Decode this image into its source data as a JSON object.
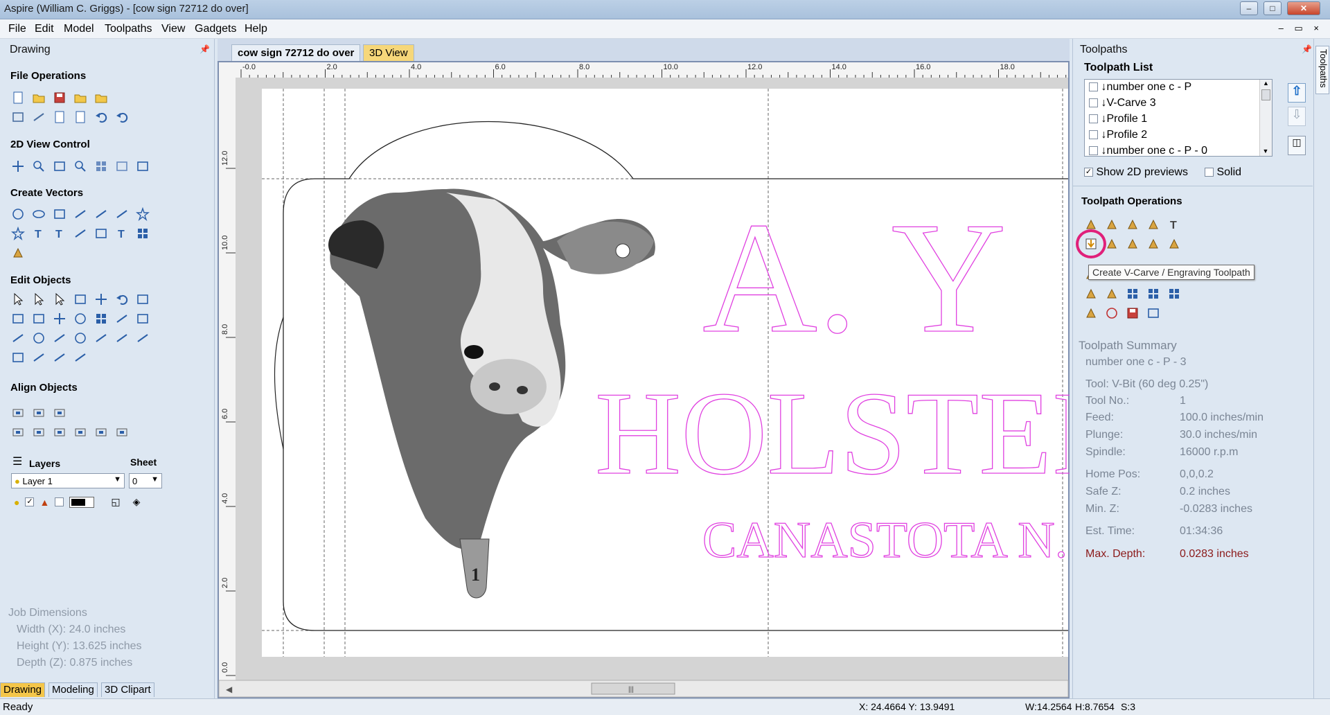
{
  "window": {
    "title": "Aspire (William C. Griggs) - [cow sign 72712 do over]"
  },
  "menu": [
    "File",
    "Edit",
    "Model",
    "Toolpaths",
    "View",
    "Gadgets",
    "Help"
  ],
  "left_panel": {
    "title": "Drawing",
    "sections": {
      "file_operations": "File Operations",
      "view_control": "2D View Control",
      "create_vectors": "Create Vectors",
      "edit_objects": "Edit Objects",
      "align_objects": "Align Objects"
    },
    "layers_label": "Layers",
    "sheet_label": "Sheet",
    "layer_select": "Layer 1",
    "sheet_select": "0",
    "job_dimensions": {
      "title": "Job Dimensions",
      "width": "Width  (X): 24.0 inches",
      "height": "Height (Y): 13.625 inches",
      "depth": "Depth  (Z): 0.875 inches"
    },
    "bottom_tabs": [
      "Drawing",
      "Modeling",
      "3D Clipart"
    ]
  },
  "document": {
    "tabs": [
      "cow sign 72712 do over",
      "3D View"
    ],
    "ruler_x": [
      "-0.0",
      "2.0",
      "4.0",
      "6.0",
      "8.0",
      "10.0",
      "12.0",
      "14.0",
      "16.0",
      "18.0"
    ],
    "ruler_y": [
      "12.0",
      "10.0",
      "8.0",
      "6.0",
      "4.0",
      "2.0",
      "0.0"
    ],
    "sign_text": {
      "line1": "A. Y",
      "line2": "HOLSTEI",
      "line3": "CANASTOTA N."
    },
    "scroll_grip": "|||"
  },
  "right_panel": {
    "title": "Toolpaths",
    "side_tab": "Toolpaths",
    "list_title": "Toolpath List",
    "toolpaths": [
      "number one c - P",
      "V-Carve 3",
      "Profile 1",
      "Profile 2",
      "number one c - P - 0"
    ],
    "show_2d_previews": "Show 2D previews",
    "solid": "Solid",
    "operations_title": "Toolpath Operations",
    "tooltip": "Create V-Carve / Engraving  Toolpath",
    "summary": {
      "title": "Toolpath Summary",
      "name": "number one c - P - 3",
      "rows": [
        {
          "label": "Tool: V-Bit (60 deg 0.25\")",
          "value": ""
        },
        {
          "label": "Tool No.:",
          "value": "1"
        },
        {
          "label": "Feed:",
          "value": "100.0 inches/min"
        },
        {
          "label": "Plunge:",
          "value": "30.0 inches/min"
        },
        {
          "label": "Spindle:",
          "value": "16000 r.p.m"
        },
        {
          "label": "Home Pos:",
          "value": "0,0,0.2"
        },
        {
          "label": "Safe Z:",
          "value": "0.2 inches"
        },
        {
          "label": "Min. Z:",
          "value": "-0.0283 inches"
        },
        {
          "label": "Est. Time:",
          "value": "01:34:36"
        },
        {
          "label": "Max. Depth:",
          "value": "0.0283 inches"
        }
      ]
    }
  },
  "status": {
    "left": "Ready",
    "coords": "X: 24.4664 Y: 13.9491",
    "w": "W:14.2564",
    "h": "H:8.7654",
    "s": "S:3"
  },
  "colors": {
    "accent": "#f2c84b",
    "vector_magenta": "#e040e0",
    "highlight_circle": "#e0207a",
    "max_depth": "#8b1a1a"
  }
}
